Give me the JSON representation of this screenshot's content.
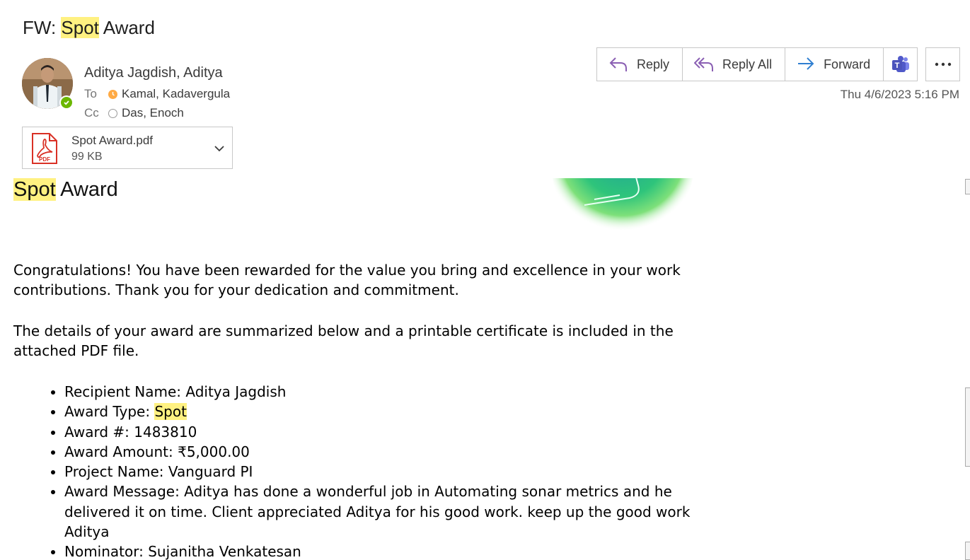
{
  "subject": {
    "prefix": "FW: ",
    "highlight": "Spot",
    "suffix": " Award"
  },
  "header": {
    "sender": "Aditya Jagdish, Aditya",
    "to_label": "To",
    "to_name": "Kamal, Kadavergula",
    "cc_label": "Cc",
    "cc_name": "Das, Enoch",
    "date": "Thu 4/6/2023 5:16 PM"
  },
  "attachment": {
    "name": "Spot Award.pdf",
    "size": "99 KB",
    "icon_label": "PDF"
  },
  "actions": {
    "reply": "Reply",
    "reply_all": "Reply All",
    "forward": "Forward"
  },
  "colors": {
    "highlight": "#fff181",
    "reply_purple": "#8a5fb3",
    "forward_blue": "#2f7fd1",
    "teams_purple": "#5059c9",
    "presence_green": "#6bb700",
    "presence_away": "#ffaa44"
  },
  "body": {
    "title_highlight": "Spot",
    "title_rest": " Award",
    "para1": "Congratulations! You have been rewarded for the value you bring and excellence in your work contributions. Thank you for your dedication and commitment.",
    "para2": "The details of your award are summarized below and a printable certificate is included in the attached PDF file.",
    "details": {
      "recipient": "Recipient Name: Aditya Jagdish",
      "type_label": "Award Type: ",
      "type_value": "Spot",
      "number": "Award #: 1483810",
      "amount": "Award Amount: ₹5,000.00",
      "project": "Project Name: Vanguard PI",
      "message": "Award Message: Aditya has done a wonderful job in Automating sonar metrics and he delivered it on time. Client appreciated Aditya for his good work. keep up the good work Aditya",
      "nominator": "Nominator: Sujanitha Venkatesan"
    }
  }
}
